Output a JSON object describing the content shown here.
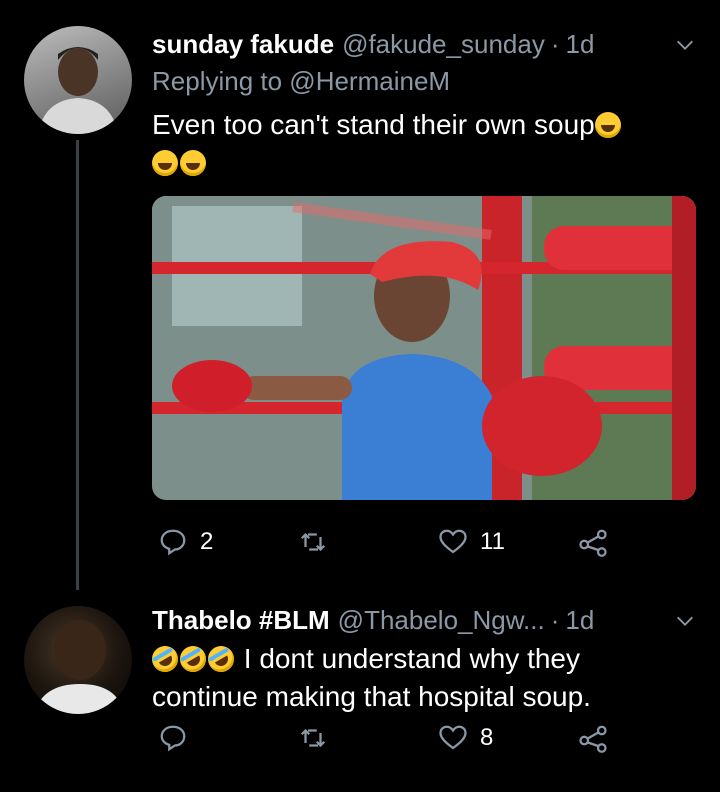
{
  "tweets": [
    {
      "name": "sunday fakude",
      "handle": "@fakude_sunday",
      "time": "1d",
      "replying_to": "Replying to @HermaineM",
      "text": "Even too can't stand their own soup",
      "emoji_after": [
        "grinning-sweat",
        "grinning-sweat",
        "grinning-sweat"
      ],
      "actions": {
        "reply_count": "2",
        "retweet_count": "",
        "like_count": "11"
      }
    },
    {
      "name": "Thabelo #BLM",
      "handle": "@Thabelo_Ngw...",
      "time": "1d",
      "emoji_before": [
        "rofl",
        "rofl",
        "rofl"
      ],
      "text": "I dont understand why they continue making that hospital soup.",
      "actions": {
        "reply_count": "",
        "retweet_count": "",
        "like_count": "8"
      }
    }
  ],
  "colors": {
    "background": "#000000",
    "secondary_text": "#8b98a5",
    "thread_line": "#3b4147"
  }
}
